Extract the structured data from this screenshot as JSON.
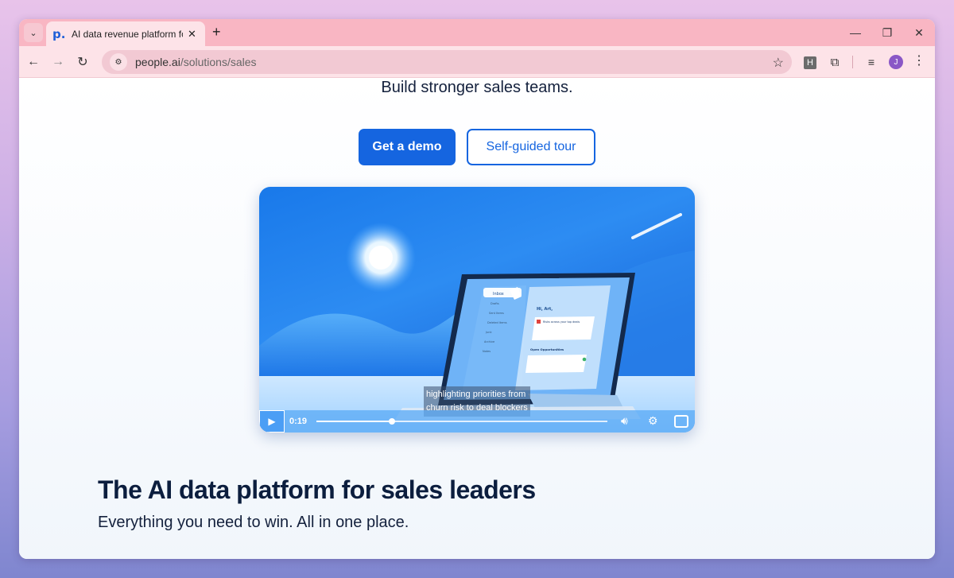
{
  "browser": {
    "tab_title": "AI data revenue platform for sales",
    "tab_favicon": "p.",
    "new_tab_symbol": "+",
    "url_host": "people.ai",
    "url_path": "/solutions/sales",
    "ext_h_label": "H",
    "avatar_initial": "J"
  },
  "hero": {
    "subtitle": "Build stronger sales teams.",
    "primary_cta": "Get a demo",
    "secondary_cta": "Self-guided tour"
  },
  "video": {
    "caption_line1": "highlighting priorities from",
    "caption_line2": "churn risk to deal blockers",
    "time": "0:19",
    "progress": 0.26,
    "app_sidebar": [
      "Inbox",
      "Drafts",
      "Sent Items",
      "Deleted Items",
      "Junk",
      "Archive",
      "Notes"
    ],
    "app_greeting": "Hi, Art,",
    "app_alert": "Risks across your top deals",
    "app_section": "Open Opportunities"
  },
  "section": {
    "title": "The AI data platform for sales leaders",
    "subtitle": "Everything you need to win. All in one place."
  },
  "colors": {
    "accent": "#1565e0",
    "tabbar": "#f9b6c3",
    "toolbar": "#fde3e8"
  }
}
